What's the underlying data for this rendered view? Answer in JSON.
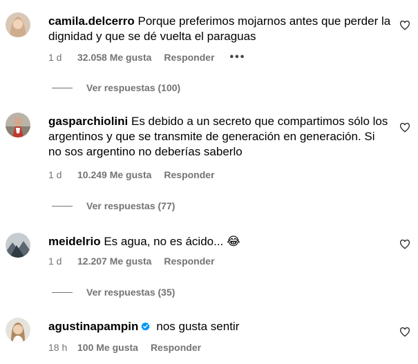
{
  "comments": [
    {
      "username": "camila.delcerro",
      "text": "Porque preferimos mojarnos antes que perder la dignidad y que se dé vuelta el paraguas",
      "age": "1 d",
      "likes": "32.058 Me gusta",
      "reply_label": "Responder",
      "more_label": "•••",
      "view_replies": "Ver respuestas (100)"
    },
    {
      "username": "gasparchiolini",
      "text": "Es debido a un secreto que compartimos sólo los argentinos y que se transmite de generación en generación. Si no sos argentino no deberías saberlo",
      "age": "1 d",
      "likes": "10.249 Me gusta",
      "reply_label": "Responder",
      "view_replies": "Ver respuestas (77)"
    },
    {
      "username": "meidelrio",
      "text": "Es agua, no es ácido... 😂",
      "age": "1 d",
      "likes": "12.207 Me gusta",
      "reply_label": "Responder",
      "view_replies": "Ver respuestas (35)"
    },
    {
      "username": "agustinapampin",
      "text": "nos gusta sentir",
      "age": "18 h",
      "likes": "100 Me gusta",
      "reply_label": "Responder",
      "verified": true
    }
  ],
  "icons": {
    "like": "heart-outline-icon",
    "verified": "verified-badge-icon"
  },
  "colors": {
    "meta_text": "#737373",
    "verified_blue": "#0095f6"
  }
}
